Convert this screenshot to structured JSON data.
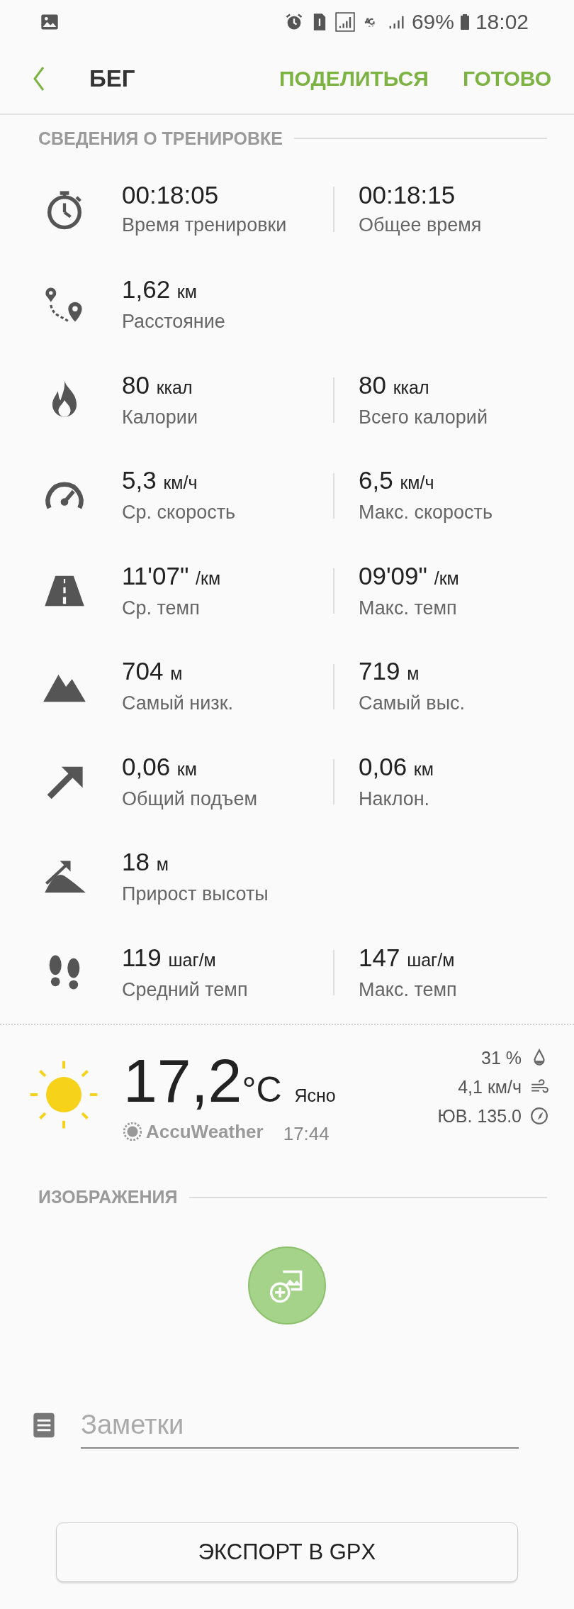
{
  "status_bar": {
    "battery": "69%",
    "time": "18:02"
  },
  "header": {
    "title": "БЕГ",
    "actions": [
      "ПОДЕЛИТЬСЯ",
      "ГОТОВО"
    ]
  },
  "workout": {
    "heading": "СВЕДЕНИЯ О ТРЕНИРОВКЕ",
    "metrics": [
      {
        "kind": "stopwatch",
        "left": {
          "value": "00:18:05",
          "label": "Время тренировки"
        },
        "right": {
          "value": "00:18:15",
          "label": "Общее время"
        }
      },
      {
        "kind": "route",
        "left": {
          "value": "1,62",
          "unit": "км",
          "label": "Расстояние"
        }
      },
      {
        "kind": "flame",
        "left": {
          "value": "80",
          "unit": "ккал",
          "label": "Калории"
        },
        "right": {
          "value": "80",
          "unit": "ккал",
          "label": "Всего калорий"
        }
      },
      {
        "kind": "speedometer",
        "left": {
          "value": "5,3",
          "unit": "км/ч",
          "label": "Ср. скорость"
        },
        "right": {
          "value": "6,5",
          "unit": "км/ч",
          "label": "Макс. скорость"
        }
      },
      {
        "kind": "road",
        "left": {
          "value": "11'07\"",
          "unit": "/км",
          "label": "Ср. темп"
        },
        "right": {
          "value": "09'09\"",
          "unit": "/км",
          "label": "Макс. темп"
        }
      },
      {
        "kind": "mountain",
        "left": {
          "value": "704",
          "unit": "м",
          "label": "Самый низк."
        },
        "right": {
          "value": "719",
          "unit": "м",
          "label": "Самый выс."
        }
      },
      {
        "kind": "arrow",
        "left": {
          "value": "0,06",
          "unit": "км",
          "label": "Общий подъем"
        },
        "right": {
          "value": "0,06",
          "unit": "км",
          "label": "Наклон."
        }
      },
      {
        "kind": "gain",
        "left": {
          "value": "18",
          "unit": "м",
          "label": "Прирост высоты"
        }
      },
      {
        "kind": "footprints",
        "left": {
          "value": "119",
          "unit": "шаг/м",
          "label": "Средний темп"
        },
        "right": {
          "value": "147",
          "unit": "шаг/м",
          "label": "Макс. темп"
        }
      }
    ]
  },
  "weather": {
    "temperature": "17,2",
    "unit": "°C",
    "condition": "Ясно",
    "provider": "AccuWeather",
    "time": "17:44",
    "details": [
      {
        "kind": "humidity",
        "text": "31 %"
      },
      {
        "kind": "wind",
        "text": "4,1 км/ч"
      },
      {
        "kind": "direction",
        "text": "ЮВ. 135.0"
      }
    ]
  },
  "images": {
    "heading": "ИЗОБРАЖЕНИЯ"
  },
  "notes": {
    "placeholder": "Заметки"
  },
  "export_button": "ЭКСПОРТ В GPX"
}
